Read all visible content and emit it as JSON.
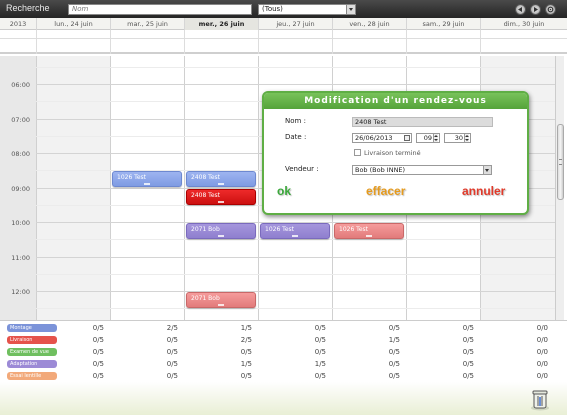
{
  "toolbar": {
    "search_label": "Recherche",
    "search_placeholder": "Nom",
    "filter_value": "(Tous)"
  },
  "calendar": {
    "year": "2013",
    "days": [
      "lun., 24 juin",
      "mar., 25 juin",
      "mer., 26 juin",
      "jeu., 27 juin",
      "ven., 28 juin",
      "sam., 29 juin",
      "dim., 30 juin"
    ],
    "today_index": 2,
    "hours": [
      "06:00",
      "07:00",
      "08:00",
      "09:00",
      "10:00",
      "11:00",
      "12:00"
    ],
    "events": [
      {
        "label": "1026 Test",
        "day": 1,
        "start": "08:30",
        "color": "blue"
      },
      {
        "label": "2408 Test",
        "day": 2,
        "start": "08:30",
        "color": "blue"
      },
      {
        "label": "2408 Test",
        "day": 2,
        "start": "09:00",
        "color": "red"
      },
      {
        "label": "2071 Bob",
        "day": 2,
        "start": "10:00",
        "color": "purple"
      },
      {
        "label": "1026 Test",
        "day": 3,
        "start": "10:00",
        "color": "purple"
      },
      {
        "label": "1026 Test",
        "day": 4,
        "start": "10:00",
        "color": "pink"
      },
      {
        "label": "2071 Bob",
        "day": 2,
        "start": "12:00",
        "color": "pink"
      }
    ]
  },
  "summary": {
    "rows": [
      {
        "label": "Montage",
        "color": "#7b93d9",
        "values": [
          "0/5",
          "2/5",
          "1/5",
          "0/5",
          "0/5",
          "0/5",
          "0/0"
        ]
      },
      {
        "label": "Livraison",
        "color": "#e5534b",
        "values": [
          "0/5",
          "0/5",
          "2/5",
          "0/5",
          "1/5",
          "0/5",
          "0/0"
        ]
      },
      {
        "label": "Examen de vue",
        "color": "#6fbf5f",
        "values": [
          "0/5",
          "0/5",
          "0/5",
          "0/5",
          "0/5",
          "0/5",
          "0/0"
        ]
      },
      {
        "label": "Adaptation",
        "color": "#9c8ad6",
        "values": [
          "0/5",
          "0/5",
          "1/5",
          "1/5",
          "0/5",
          "0/5",
          "0/0"
        ]
      },
      {
        "label": "Essai lentille",
        "color": "#f2a97a",
        "values": [
          "0/5",
          "0/5",
          "0/5",
          "0/5",
          "0/5",
          "0/5",
          "0/0"
        ]
      }
    ]
  },
  "dialog": {
    "title": "Modification d'un rendez-vous",
    "name_label": "Nom :",
    "name_value": "2408 Test",
    "date_label": "Date :",
    "date_value": "26/06/2013",
    "hour_value": "09",
    "minute_value": "30",
    "delivery_label": "Livraison terminé",
    "seller_label": "Vendeur :",
    "seller_value": "Bob (Bob INNE)",
    "ok_label": "ok",
    "delete_label": "effacer",
    "cancel_label": "annuler",
    "colors": {
      "ok": "#3aa83a",
      "delete": "#e69b1e",
      "cancel": "#e03a2a",
      "title_bar": "#5fae45"
    }
  }
}
